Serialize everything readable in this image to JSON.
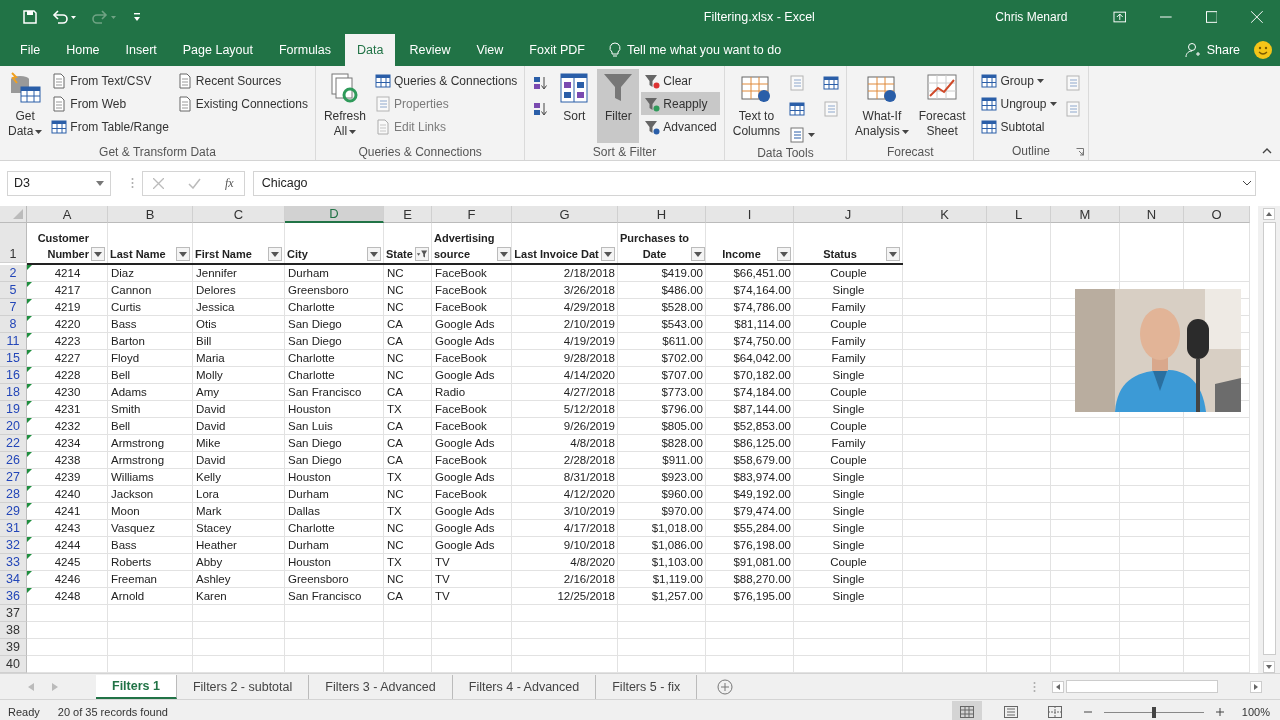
{
  "title_bar": {
    "title": "Filtering.xlsx  -  Excel",
    "user": "Chris Menard"
  },
  "menu_tabs": [
    {
      "label": "File",
      "selected": false
    },
    {
      "label": "Home",
      "selected": false
    },
    {
      "label": "Insert",
      "selected": false
    },
    {
      "label": "Page Layout",
      "selected": false
    },
    {
      "label": "Formulas",
      "selected": false
    },
    {
      "label": "Data",
      "selected": true
    },
    {
      "label": "Review",
      "selected": false
    },
    {
      "label": "View",
      "selected": false
    },
    {
      "label": "Foxit PDF",
      "selected": false
    }
  ],
  "tell_me": "Tell me what you want to do",
  "share": "Share",
  "ribbon_groups": [
    {
      "label": "Get & Transform Data",
      "columns": [
        [
          {
            "kind": "large",
            "lines": [
              "Get",
              "Data"
            ],
            "dropdown": true
          }
        ],
        [
          {
            "kind": "small",
            "label": "From Text/CSV"
          },
          {
            "kind": "small",
            "label": "From Web"
          },
          {
            "kind": "small",
            "label": "From Table/Range"
          }
        ],
        [
          {
            "kind": "small",
            "label": "Recent Sources"
          },
          {
            "kind": "small",
            "label": "Existing Connections"
          }
        ]
      ]
    },
    {
      "label": "Queries & Connections",
      "columns": [
        [
          {
            "kind": "large",
            "lines": [
              "Refresh",
              "All"
            ],
            "dropdown": true
          }
        ],
        [
          {
            "kind": "small",
            "label": "Queries & Connections"
          },
          {
            "kind": "small",
            "label": "Properties",
            "disabled": true
          },
          {
            "kind": "small",
            "label": "Edit Links",
            "disabled": true
          }
        ]
      ]
    },
    {
      "label": "Sort & Filter",
      "columns": [
        [
          {
            "kind": "icon"
          },
          {
            "kind": "icon"
          }
        ],
        [
          {
            "kind": "large",
            "lines": [
              "Sort"
            ]
          }
        ],
        [
          {
            "kind": "large",
            "lines": [
              "Filter"
            ],
            "selected": true
          }
        ],
        [
          {
            "kind": "small",
            "label": "Clear"
          },
          {
            "kind": "small",
            "label": "Reapply",
            "highlighted": true
          },
          {
            "kind": "small",
            "label": "Advanced"
          }
        ]
      ]
    },
    {
      "label": "Data Tools",
      "columns": [
        [
          {
            "kind": "large",
            "lines": [
              "Text to",
              "Columns"
            ]
          }
        ],
        [
          {
            "kind": "icon",
            "disabled": true
          },
          {
            "kind": "icon"
          },
          {
            "kind": "icon",
            "dropdown": true
          }
        ],
        [
          {
            "kind": "icon"
          },
          {
            "kind": "icon",
            "disabled": true
          }
        ]
      ]
    },
    {
      "label": "Forecast",
      "columns": [
        [
          {
            "kind": "large",
            "lines": [
              "What-If",
              "Analysis"
            ],
            "dropdown": true
          }
        ],
        [
          {
            "kind": "large",
            "lines": [
              "Forecast",
              "Sheet"
            ]
          }
        ]
      ]
    },
    {
      "label": "Outline",
      "launcher": true,
      "columns": [
        [
          {
            "kind": "small",
            "label": "Group",
            "dropdown": true
          },
          {
            "kind": "small",
            "label": "Ungroup",
            "dropdown": true
          },
          {
            "kind": "small",
            "label": "Subtotal"
          }
        ],
        [
          {
            "kind": "icon",
            "disabled": true
          },
          {
            "kind": "icon",
            "disabled": true
          }
        ]
      ]
    }
  ],
  "formula_bar": {
    "name_box": "D3",
    "fx": "fx",
    "value": "Chicago"
  },
  "column_letters": [
    {
      "label": "A",
      "selected": false
    },
    {
      "label": "B",
      "selected": false
    },
    {
      "label": "C",
      "selected": false
    },
    {
      "label": "D",
      "selected": true
    },
    {
      "label": "E",
      "selected": false
    },
    {
      "label": "F",
      "selected": false
    },
    {
      "label": "G",
      "selected": false
    },
    {
      "label": "H",
      "selected": false
    },
    {
      "label": "I",
      "selected": false
    },
    {
      "label": "J",
      "selected": false
    },
    {
      "label": "K",
      "selected": false
    },
    {
      "label": "L",
      "selected": false
    },
    {
      "label": "M",
      "selected": false
    },
    {
      "label": "N",
      "selected": false
    },
    {
      "label": "O",
      "selected": false
    }
  ],
  "number_as_text_warning": true,
  "header_row": {
    "row": "1",
    "cells": [
      {
        "lines": [
          "Customer",
          "Number"
        ],
        "filtered": false
      },
      {
        "lines": [
          "Last Name"
        ],
        "filtered": false
      },
      {
        "lines": [
          "First Name"
        ],
        "filtered": false
      },
      {
        "lines": [
          "City"
        ],
        "filtered": false
      },
      {
        "lines": [
          "State"
        ],
        "filtered": true
      },
      {
        "lines": [
          "Advertising",
          "source"
        ],
        "filtered": false
      },
      {
        "lines": [
          "Last Invoice Dat"
        ],
        "filtered": false
      },
      {
        "lines": [
          "Purchases to",
          "Date"
        ],
        "filtered": false
      },
      {
        "lines": [
          "Income"
        ],
        "filtered": false
      },
      {
        "lines": [
          "Status"
        ],
        "filtered": false
      }
    ]
  },
  "rows": [
    {
      "row": "2",
      "cells": [
        "4214",
        "Diaz",
        "Jennifer",
        "Durham",
        "NC",
        "FaceBook",
        "2/18/2018",
        "$419.00",
        "$66,451.00",
        "Couple"
      ]
    },
    {
      "row": "5",
      "cells": [
        "4217",
        "Cannon",
        "Delores",
        "Greensboro",
        "NC",
        "FaceBook",
        "3/26/2018",
        "$486.00",
        "$74,164.00",
        "Single"
      ]
    },
    {
      "row": "7",
      "cells": [
        "4219",
        "Curtis",
        "Jessica",
        "Charlotte",
        "NC",
        "FaceBook",
        "4/29/2018",
        "$528.00",
        "$74,786.00",
        "Family"
      ]
    },
    {
      "row": "8",
      "cells": [
        "4220",
        "Bass",
        "Otis",
        "San Diego",
        "CA",
        "Google Ads",
        "2/10/2019",
        "$543.00",
        "$81,114.00",
        "Couple"
      ]
    },
    {
      "row": "11",
      "cells": [
        "4223",
        "Barton",
        "Bill",
        "San Diego",
        "CA",
        "Google Ads",
        "4/19/2019",
        "$611.00",
        "$74,750.00",
        "Family"
      ]
    },
    {
      "row": "15",
      "cells": [
        "4227",
        "Floyd",
        "Maria",
        "Charlotte",
        "NC",
        "FaceBook",
        "9/28/2018",
        "$702.00",
        "$64,042.00",
        "Family"
      ]
    },
    {
      "row": "16",
      "cells": [
        "4228",
        "Bell",
        "Molly",
        "Charlotte",
        "NC",
        "Google Ads",
        "4/14/2020",
        "$707.00",
        "$70,182.00",
        "Single"
      ]
    },
    {
      "row": "18",
      "cells": [
        "4230",
        "Adams",
        "Amy",
        "San Francisco",
        "CA",
        "Radio",
        "4/27/2018",
        "$773.00",
        "$74,184.00",
        "Couple"
      ]
    },
    {
      "row": "19",
      "cells": [
        "4231",
        "Smith",
        "David",
        "Houston",
        "TX",
        "FaceBook",
        "5/12/2018",
        "$796.00",
        "$87,144.00",
        "Single"
      ]
    },
    {
      "row": "20",
      "cells": [
        "4232",
        "Bell",
        "David",
        "San Luis",
        "CA",
        "FaceBook",
        "9/26/2019",
        "$805.00",
        "$52,853.00",
        "Couple"
      ]
    },
    {
      "row": "22",
      "cells": [
        "4234",
        "Armstrong",
        "Mike",
        "San Diego",
        "CA",
        "Google Ads",
        "4/8/2018",
        "$828.00",
        "$86,125.00",
        "Family"
      ]
    },
    {
      "row": "26",
      "cells": [
        "4238",
        "Armstrong",
        "David",
        "San Diego",
        "CA",
        "FaceBook",
        "2/28/2018",
        "$911.00",
        "$58,679.00",
        "Couple"
      ]
    },
    {
      "row": "27",
      "cells": [
        "4239",
        "Williams",
        "Kelly",
        "Houston",
        "TX",
        "Google Ads",
        "8/31/2018",
        "$923.00",
        "$83,974.00",
        "Single"
      ]
    },
    {
      "row": "28",
      "cells": [
        "4240",
        "Jackson",
        "Lora",
        "Durham",
        "NC",
        "FaceBook",
        "4/12/2020",
        "$960.00",
        "$49,192.00",
        "Single"
      ]
    },
    {
      "row": "29",
      "cells": [
        "4241",
        "Moon",
        "Mark",
        "Dallas",
        "TX",
        "Google Ads",
        "3/10/2019",
        "$970.00",
        "$79,474.00",
        "Single"
      ]
    },
    {
      "row": "31",
      "cells": [
        "4243",
        "Vasquez",
        "Stacey",
        "Charlotte",
        "NC",
        "Google Ads",
        "4/17/2018",
        "$1,018.00",
        "$55,284.00",
        "Single"
      ]
    },
    {
      "row": "32",
      "cells": [
        "4244",
        "Bass",
        "Heather",
        "Durham",
        "NC",
        "Google Ads",
        "9/10/2018",
        "$1,086.00",
        "$76,198.00",
        "Single"
      ]
    },
    {
      "row": "33",
      "cells": [
        "4245",
        "Roberts",
        "Abby",
        "Houston",
        "TX",
        "TV",
        "4/8/2020",
        "$1,103.00",
        "$91,081.00",
        "Couple"
      ]
    },
    {
      "row": "34",
      "cells": [
        "4246",
        "Freeman",
        "Ashley",
        "Greensboro",
        "NC",
        "TV",
        "2/16/2018",
        "$1,119.00",
        "$88,270.00",
        "Single"
      ]
    },
    {
      "row": "36",
      "cells": [
        "4248",
        "Arnold",
        "Karen",
        "San Francisco",
        "CA",
        "TV",
        "12/25/2018",
        "$1,257.00",
        "$76,195.00",
        "Single"
      ]
    }
  ],
  "empty_rows": [
    "37",
    "38",
    "39",
    "40"
  ],
  "webcam": {
    "kind": "picture"
  },
  "sheet_tabs": [
    {
      "label": "Filters 1",
      "selected": true
    },
    {
      "label": "Filters 2 - subtotal",
      "selected": false
    },
    {
      "label": "Filters 3 - Advanced",
      "selected": false
    },
    {
      "label": "Filters 4 - Advanced",
      "selected": false
    },
    {
      "label": "Filters 5 - fix",
      "selected": false
    }
  ],
  "status_bar": {
    "mode": "Ready",
    "message": "20 of 35 records found",
    "view_buttons": [
      {
        "selected": true
      },
      {
        "selected": false
      },
      {
        "selected": false
      }
    ],
    "zoom": {
      "level": 0.5,
      "reading": "100%"
    }
  }
}
